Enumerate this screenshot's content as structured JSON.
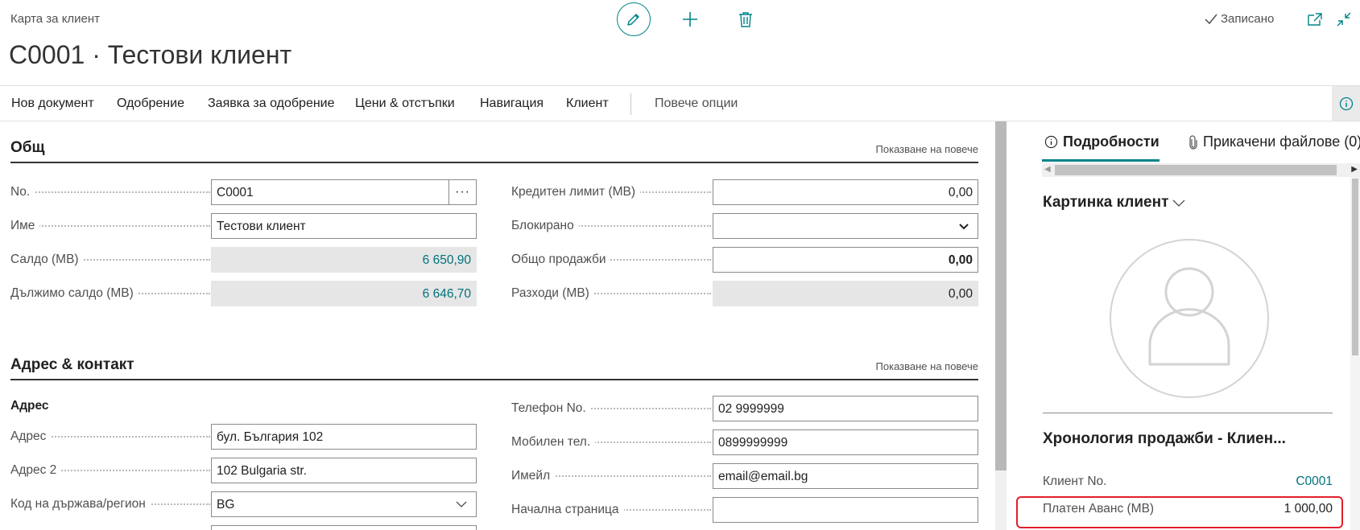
{
  "header": {
    "breadcrumb": "Карта за клиент",
    "title": "C0001 · Тестови клиент",
    "status": "Записано"
  },
  "actions": {
    "items": [
      "Нов документ",
      "Одобрение",
      "Заявка за одобрение",
      "Цени & отстъпки",
      "Навигация",
      "Клиент"
    ],
    "more": "Повече опции"
  },
  "general": {
    "title": "Общ",
    "show_more": "Показване на повече",
    "no_label": "No.",
    "no_value": "C0001",
    "lookup": "···",
    "name_label": "Име",
    "name_value": "Тестови клиент",
    "balance_label": "Салдо (МВ)",
    "balance_value": "6 650,90",
    "balance_due_label": "Дължимо салдо (МВ)",
    "balance_due_value": "6 646,70",
    "credit_limit_label": "Кредитен лимит (МВ)",
    "credit_limit_value": "0,00",
    "blocked_label": "Блокирано",
    "blocked_value": "",
    "total_sales_label": "Общо продажби",
    "total_sales_value": "0,00",
    "costs_label": "Разходи (МВ)",
    "costs_value": "0,00"
  },
  "address": {
    "title": "Адрес & контакт",
    "show_more": "Показване на повече",
    "subheading": "Адрес",
    "address_label": "Адрес",
    "address_value": "бул. България 102",
    "address2_label": "Адрес 2",
    "address2_value": "102 Bulgaria str.",
    "country_label": "Код на държава/регион",
    "country_value": "BG",
    "phone_label": "Телефон No.",
    "phone_value": "02 9999999",
    "mobile_label": "Мобилен тел.",
    "mobile_value": "0899999999",
    "email_label": "Имейл",
    "email_value": "email@email.bg",
    "homepage_label": "Начална страница",
    "homepage_value": ""
  },
  "factbox": {
    "tab_details": "Подробности",
    "tab_attachments": "Прикачени файлове (0)",
    "picture_title": "Картинка клиент",
    "history_title": "Хронология продажби - Клиен...",
    "customer_no_label": "Клиент No.",
    "customer_no_value": "C0001",
    "paid_advance_label": "Платен Аванс (МВ)",
    "paid_advance_value": "1 000,00"
  },
  "icons": [
    "edit-icon",
    "add-icon",
    "delete-icon",
    "checkmark-icon",
    "popout-icon",
    "collapse-icon",
    "info-icon",
    "chevron-down-icon",
    "paperclip-icon",
    "person-icon"
  ],
  "colors": {
    "accent": "#008489",
    "link": "#00727b",
    "highlight": "#e0202a",
    "readonly_bg": "#e6e6e6"
  }
}
